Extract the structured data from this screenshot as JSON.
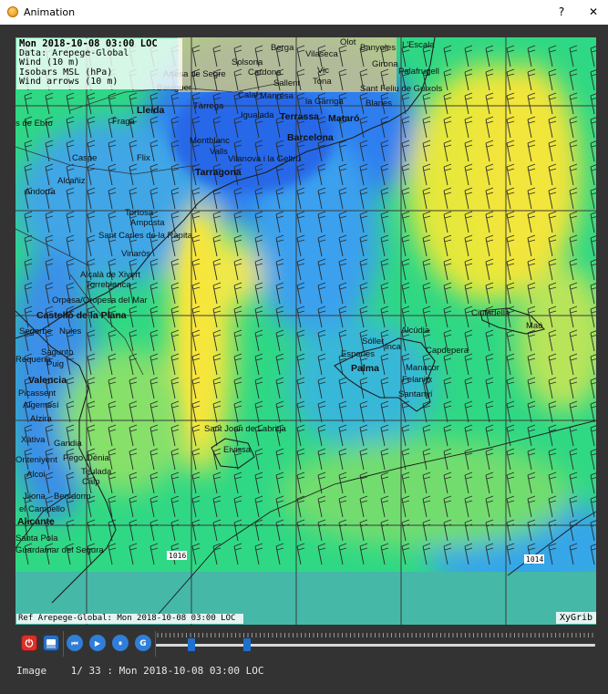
{
  "window": {
    "title": "Animation",
    "help_label": "?",
    "close_label": "✕"
  },
  "map": {
    "legend": {
      "line1": "Mon 2018-10-08 03:00 LOC",
      "line2": "Data: Arepege-Global",
      "line3": "Wind (10 m)",
      "line4": "Isobars MSL (hPa)",
      "line5": "Wind arrows (10 m)"
    },
    "reference": "Ref Arepege-Global: Mon 2018-10-08 03:00 LOC",
    "brand": "XyGrib",
    "isobars": [
      "1016",
      "1014"
    ],
    "places": [
      {
        "name": "Berga",
        "bold": false
      },
      {
        "name": "Olot",
        "bold": false
      },
      {
        "name": "Banyoles",
        "bold": false
      },
      {
        "name": "L'Escala",
        "bold": false
      },
      {
        "name": "Vilaseca",
        "bold": false
      },
      {
        "name": "Solsona",
        "bold": false
      },
      {
        "name": "Girona",
        "bold": false
      },
      {
        "name": "Palafrugell",
        "bold": false
      },
      {
        "name": "Artesa de Segre",
        "bold": false
      },
      {
        "name": "Cardona",
        "bold": false
      },
      {
        "name": "Vic",
        "bold": false
      },
      {
        "name": "Balaguer",
        "bold": false
      },
      {
        "name": "Sallent",
        "bold": false
      },
      {
        "name": "Tona",
        "bold": false
      },
      {
        "name": "Sant Feliu de Guixols",
        "bold": false
      },
      {
        "name": "Calaf",
        "bold": false
      },
      {
        "name": "Manresa",
        "bold": false
      },
      {
        "name": "Lleida",
        "bold": true
      },
      {
        "name": "Tàrrega",
        "bold": false
      },
      {
        "name": "la Garriga",
        "bold": false
      },
      {
        "name": "Blanes",
        "bold": false
      },
      {
        "name": "Igualada",
        "bold": false
      },
      {
        "name": "Terrassa",
        "bold": true
      },
      {
        "name": "Mataró",
        "bold": true
      },
      {
        "name": "Fraga",
        "bold": false
      },
      {
        "name": "s de Ebro",
        "bold": false
      },
      {
        "name": "Montblanc",
        "bold": false
      },
      {
        "name": "Barcelona",
        "bold": true
      },
      {
        "name": "Valls",
        "bold": false
      },
      {
        "name": "Caspe",
        "bold": false
      },
      {
        "name": "Flix",
        "bold": false
      },
      {
        "name": "Vilanova i la Geltrú",
        "bold": false
      },
      {
        "name": "Tarragona",
        "bold": true
      },
      {
        "name": "Alcañiz",
        "bold": false
      },
      {
        "name": "Andorra",
        "bold": false
      },
      {
        "name": "Tortosa",
        "bold": false
      },
      {
        "name": "Amposta",
        "bold": false
      },
      {
        "name": "Sant Carles de la Ràpita",
        "bold": false
      },
      {
        "name": "Vinaròs",
        "bold": false
      },
      {
        "name": "Alcalà de Xivert",
        "bold": false
      },
      {
        "name": "Torreblanca",
        "bold": false
      },
      {
        "name": "Orpesa/Oropesa del Mar",
        "bold": false
      },
      {
        "name": "Ciutadella",
        "bold": false
      },
      {
        "name": "Castelló de la Plana",
        "bold": true
      },
      {
        "name": "Maó",
        "bold": false
      },
      {
        "name": "Segorbe",
        "bold": false
      },
      {
        "name": "Nules",
        "bold": false
      },
      {
        "name": "Alcúdia",
        "bold": false
      },
      {
        "name": "Sóller",
        "bold": false
      },
      {
        "name": "Inca",
        "bold": false
      },
      {
        "name": "Sagunto",
        "bold": false
      },
      {
        "name": "Esporles",
        "bold": false
      },
      {
        "name": "Capdepera",
        "bold": false
      },
      {
        "name": "Puig",
        "bold": false
      },
      {
        "name": "Palma",
        "bold": true
      },
      {
        "name": "Manacor",
        "bold": false
      },
      {
        "name": "Valencia",
        "bold": true
      },
      {
        "name": "Felanitx",
        "bold": false
      },
      {
        "name": "Picassent",
        "bold": false
      },
      {
        "name": "Santanyí",
        "bold": false
      },
      {
        "name": "Algemesí",
        "bold": false
      },
      {
        "name": "Alzira",
        "bold": false
      },
      {
        "name": "Xàtiva",
        "bold": false
      },
      {
        "name": "Sant Joan de Labritja",
        "bold": false
      },
      {
        "name": "Gandia",
        "bold": false
      },
      {
        "name": "Eivissa",
        "bold": false
      },
      {
        "name": "Pego",
        "bold": false
      },
      {
        "name": "Dénia",
        "bold": false
      },
      {
        "name": "Teulada",
        "bold": false
      },
      {
        "name": "Calp",
        "bold": false
      },
      {
        "name": "Alcoi",
        "bold": false
      },
      {
        "name": "Jijona",
        "bold": false
      },
      {
        "name": "Benidorm",
        "bold": false
      },
      {
        "name": "el Campello",
        "bold": false
      },
      {
        "name": "Alicante",
        "bold": true
      },
      {
        "name": "Santa Pola",
        "bold": false
      },
      {
        "name": "Guardamar del Segura",
        "bold": false
      },
      {
        "name": "Onteniyent",
        "bold": false
      },
      {
        "name": "Requena",
        "bold": false
      }
    ]
  },
  "toolbar": {
    "buttons": [
      {
        "icon": "power-icon",
        "label": "⏻",
        "color": "#d9302a"
      },
      {
        "icon": "save-icon",
        "label": "",
        "color": "#2b6fc4"
      },
      {
        "icon": "rewind-icon",
        "label": "⏮",
        "color": "#2f7ed8"
      },
      {
        "icon": "play-icon",
        "label": "▶",
        "color": "#2f7ed8"
      },
      {
        "icon": "pause-icon",
        "label": "⏸",
        "color": "#2f7ed8"
      },
      {
        "icon": "loop-icon",
        "label": "G",
        "color": "#2f7ed8"
      }
    ],
    "speed_slider_level": 0.35,
    "frame_slider_position": 0.0,
    "accent": "#1e6fd0"
  },
  "status": {
    "text": "Image    1/ 33 : Mon 2018-10-08 03:00 LOC"
  }
}
